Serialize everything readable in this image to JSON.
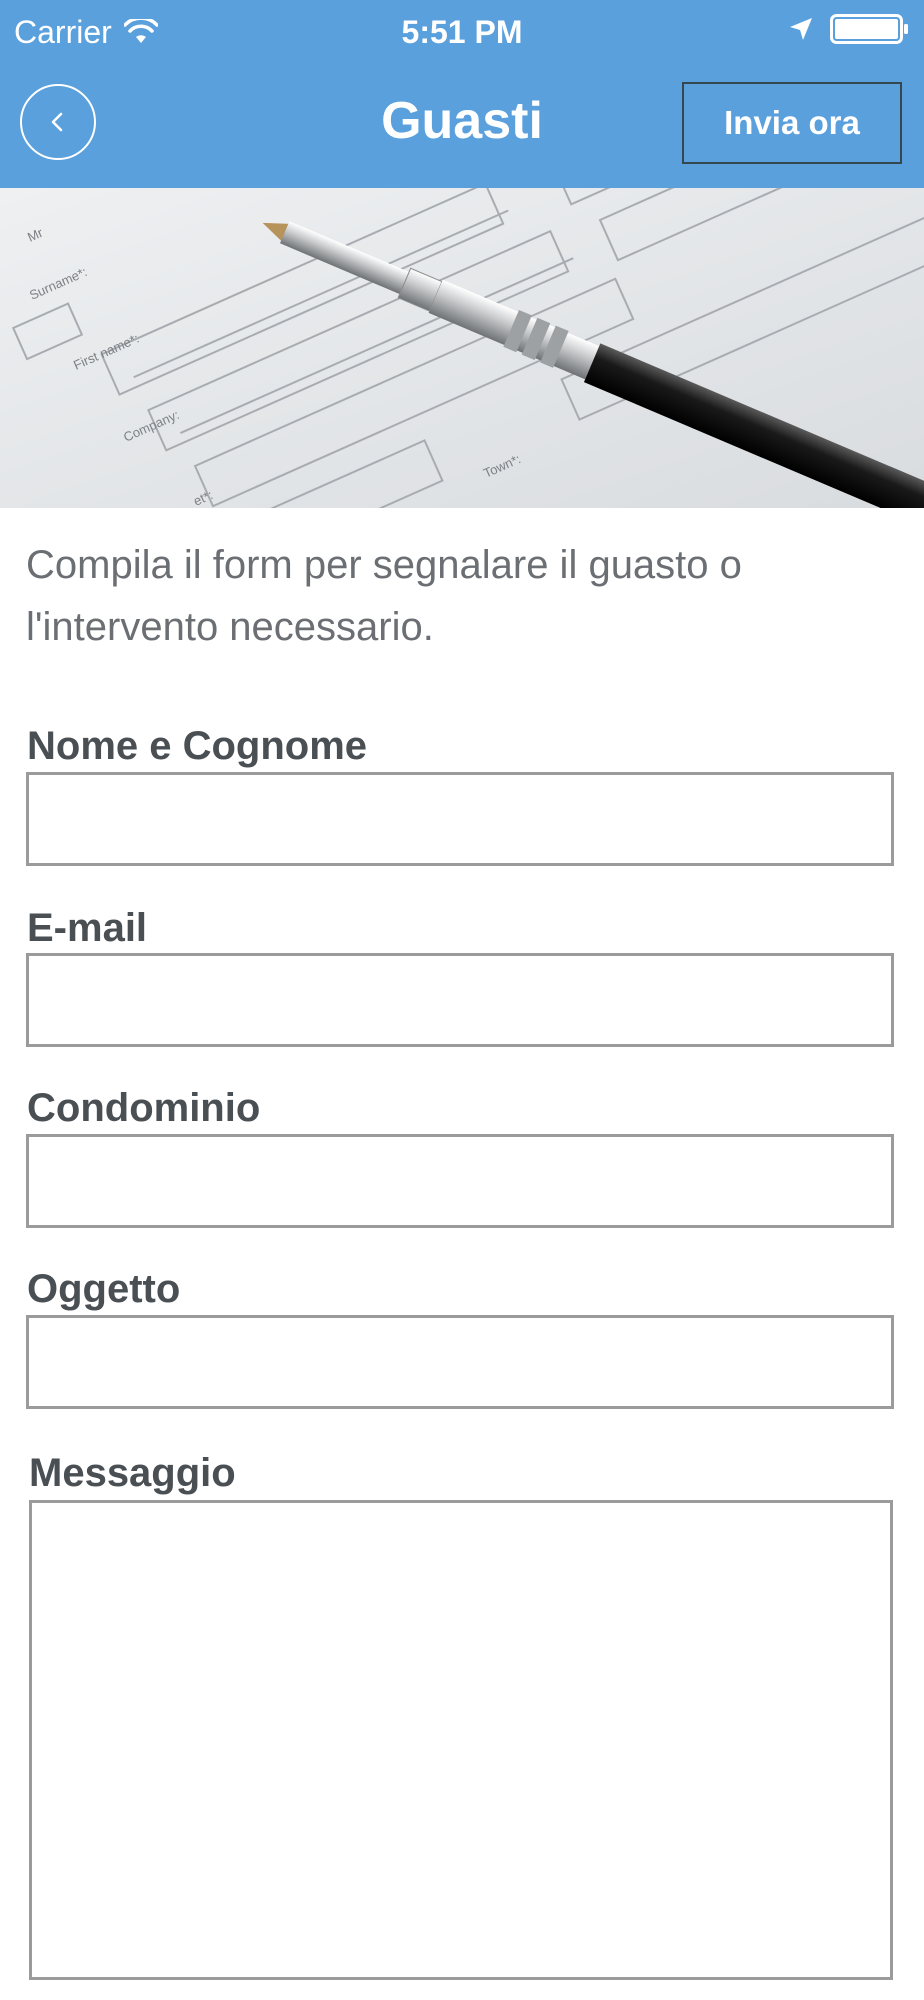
{
  "status_bar": {
    "carrier": "Carrier",
    "time": "5:51 PM",
    "icons": [
      "wifi-icon",
      "location-arrow-icon",
      "battery-icon"
    ]
  },
  "nav": {
    "back_icon": "chevron-left-icon",
    "title": "Guasti",
    "send_label": "Invia ora"
  },
  "hero": {
    "image": "form-with-pen-photo",
    "form_labels": [
      "Mr",
      "Surname*:",
      "First name*:",
      "Company:",
      "Town*:",
      "...et*:"
    ]
  },
  "intro_text": "Compila il form per segnalare il guasto o l'intervento necessario.",
  "form": {
    "fields": [
      {
        "label": "Nome e Cognome",
        "value": ""
      },
      {
        "label": "E-mail",
        "value": ""
      },
      {
        "label": "Condominio",
        "value": ""
      },
      {
        "label": "Oggetto",
        "value": ""
      },
      {
        "label": "Messaggio",
        "value": ""
      }
    ]
  },
  "colors": {
    "header_bg": "#5aa0dc",
    "header_text": "#ffffff",
    "label_text": "#4a4f54",
    "intro_text": "#6b6f73",
    "input_border": "#9b9b9b"
  }
}
